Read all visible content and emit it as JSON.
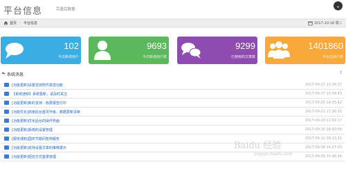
{
  "header": {
    "title": "平台信息",
    "subtitle": "完善后数据"
  },
  "breadcrumb": {
    "home": "首页",
    "separator": "›",
    "current": "平台信息",
    "date": "2017-10-18 周二"
  },
  "stats": [
    {
      "value": "102",
      "label": "今日新增用户",
      "icon": "comment-icon",
      "color": "#3aaee2"
    },
    {
      "value": "9693",
      "label": "今日新增用户数",
      "icon": "user-icon",
      "color": "#5bb85d"
    },
    {
      "value": "9299",
      "label": "已使用的文章数",
      "icon": "comments-icon",
      "color": "#8e4bb0"
    },
    {
      "value": "1401860",
      "label": "平台总用户数",
      "icon": "users-icon",
      "color": "#f9a83a"
    }
  ],
  "system_section": {
    "title": "系统消息"
  },
  "messages": [
    {
      "text": "[功能更新]设置支持附件发送功能",
      "time": "2017-09-27 13:18:37"
    },
    {
      "text": "【系统通知】系统更新，请及时关注",
      "time": "2017-09-27 10:58:43"
    },
    {
      "text": "[功能更新]新的支持：收费报告打印",
      "time": "2017-09-25 14:35:42"
    },
    {
      "text": "[功能优化]商家后台首页升级，数据更新清晰",
      "time": "2017-09-21 17:26:31"
    },
    {
      "text": "[功能更新]优化后台的操作界面",
      "time": "2017-09-19 11:02:17"
    },
    {
      "text": "[功能更新]系统的设置管理",
      "time": "2017-09-15 16:40:58"
    },
    {
      "text": "[服务通知]国庆节期间暂停服务",
      "time": "2017-09-12 09:13:25"
    },
    {
      "text": "[功能更新]支持设置文章的推荐展示",
      "time": "2017-09-08 14:27:03"
    },
    {
      "text": "[功能更新]短信方式登录管理",
      "time": "2017-09-05 10:48:36"
    }
  ],
  "watermark": {
    "text": "Baidu 经验",
    "url": "jingyan.baidu.com"
  }
}
